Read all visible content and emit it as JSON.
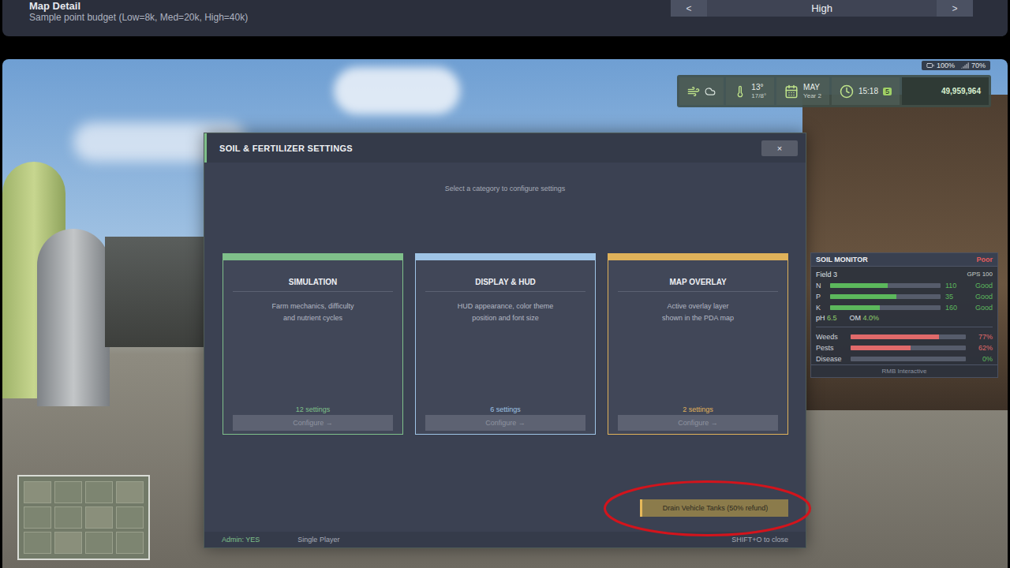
{
  "settings_row": {
    "title": "Map Detail",
    "description": "Sample point budget (Low=8k, Med=20k, High=40k)",
    "prev": "<",
    "value": "High",
    "next": ">"
  },
  "device_status": [
    {
      "kind": "battery",
      "value": "100%"
    },
    {
      "kind": "signal",
      "value": "70%"
    }
  ],
  "hud": {
    "temperature": "13°",
    "temperature_range": "17/8°",
    "month": "MAY",
    "year": "Year 2",
    "time": "15:18",
    "time_scale": "5",
    "money": "49,959,964"
  },
  "dialog": {
    "title": "SOIL & FERTILIZER SETTINGS",
    "close": "×",
    "subtitle": "Select a category to configure settings",
    "cards": [
      {
        "title": "SIMULATION",
        "description": [
          "Farm mechanics, difficulty",
          "and nutrient cycles"
        ],
        "count": "12 settings",
        "button": "Configure →",
        "color": "#7fc08a"
      },
      {
        "title": "DISPLAY & HUD",
        "description": [
          "HUD appearance, color theme",
          "position and font size"
        ],
        "count": "6 settings",
        "button": "Configure →",
        "color": "#9fc4e6"
      },
      {
        "title": "MAP OVERLAY",
        "description": [
          "Active overlay layer",
          "shown in the PDA map"
        ],
        "count": "2 settings",
        "button": "Configure →",
        "color": "#e0b25a"
      }
    ],
    "action_button": {
      "label": "Drain Vehicle Tanks (50% refund)",
      "highlighted": true
    },
    "footer": {
      "admin": "Admin: YES",
      "mode": "Single Player",
      "hint": "SHIFT+O to close"
    }
  },
  "soil_monitor": {
    "title": "SOIL MONITOR",
    "rating": "Poor",
    "field": "Field 3",
    "field_info": "GPS 100",
    "nutrients": [
      {
        "label": "N",
        "value": "110",
        "level": 0.52,
        "status": "Good",
        "color": "#5cb85c"
      },
      {
        "label": "P",
        "value": "35",
        "level": 0.6,
        "status": "Good",
        "color": "#5cb85c"
      },
      {
        "label": "K",
        "value": "160",
        "level": 0.45,
        "status": "Good",
        "color": "#5cb85c"
      }
    ],
    "ph_label": "pH",
    "ph": "6.5",
    "om_label": "OM",
    "om": "4.0%",
    "threats": [
      {
        "label": "Weeds",
        "value": "77%",
        "level": 0.77,
        "color": "#e06a6a"
      },
      {
        "label": "Pests",
        "value": "62%",
        "level": 0.52,
        "color": "#e06a6a"
      },
      {
        "label": "Disease",
        "value": "0%",
        "level": 0,
        "color": "#5cb85c"
      }
    ],
    "footer": "RMB Interactive"
  }
}
